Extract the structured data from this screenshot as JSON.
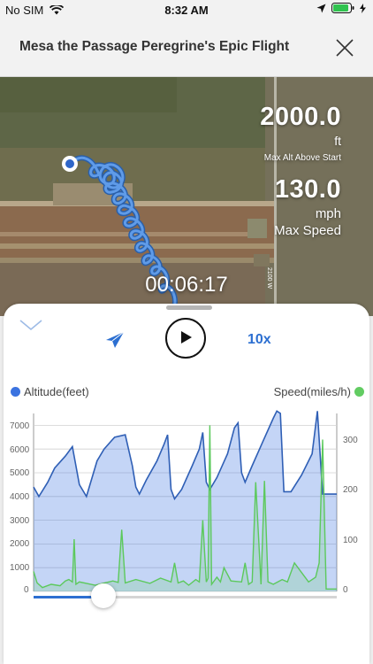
{
  "status_bar": {
    "carrier": "No SIM",
    "time": "8:32 AM"
  },
  "header": {
    "title": "Mesa the Passage Peregrine's Epic Flight"
  },
  "stats": {
    "altitude_value": "2000.0",
    "altitude_unit": "ft",
    "altitude_label": "Max Alt Above Start",
    "speed_value": "130.0",
    "speed_unit": "mph",
    "speed_label": "Max Speed"
  },
  "map": {
    "road_label": "2100 W"
  },
  "timer": "00:06:17",
  "controls": {
    "speed_multiplier": "10x",
    "playback_progress": 0.23
  },
  "colors": {
    "altitude": "#3b73e0",
    "speed": "#62cc62",
    "accent": "#2c6fd1"
  },
  "chart_data": {
    "type": "area",
    "series": [
      {
        "name": "Altitude(feet)",
        "axis": "left",
        "color": "#3b73e0",
        "x": [
          0,
          3,
          8,
          12,
          18,
          22,
          26,
          30,
          32,
          34,
          36,
          40,
          46,
          52,
          56,
          58,
          60,
          64,
          70,
          74,
          76,
          78,
          80,
          84,
          90,
          94,
          96,
          98,
          100,
          104,
          110,
          114,
          116,
          118,
          120,
          124,
          130,
          136,
          138,
          140,
          142,
          146,
          152,
          158,
          161,
          164,
          168,
          172
        ],
        "y": [
          4400,
          4000,
          4600,
          5200,
          5700,
          6100,
          4500,
          4000,
          4500,
          5000,
          5500,
          6000,
          6500,
          6600,
          5300,
          4400,
          4100,
          4700,
          5500,
          6200,
          6600,
          4300,
          3900,
          4300,
          5300,
          6000,
          6700,
          4600,
          4300,
          4800,
          5800,
          6900,
          7100,
          5000,
          4600,
          5300,
          6300,
          7300,
          7600,
          7500,
          4200,
          4200,
          4900,
          5800,
          7600,
          4100,
          4100,
          4100
        ]
      },
      {
        "name": "Speed(miles/h)",
        "axis": "right",
        "color": "#62cc62",
        "x": [
          0,
          2,
          5,
          10,
          15,
          18,
          20,
          22,
          23,
          24,
          26,
          35,
          45,
          48,
          50,
          52,
          58,
          66,
          72,
          78,
          80,
          82,
          85,
          88,
          92,
          94,
          96,
          98,
          99,
          100,
          101,
          104,
          106,
          108,
          112,
          118,
          120,
          122,
          124,
          126,
          129,
          131,
          133,
          136,
          141,
          144,
          148,
          156,
          160,
          162,
          164,
          166,
          168,
          172
        ],
        "y": [
          42,
          18,
          8,
          15,
          12,
          22,
          25,
          20,
          110,
          15,
          20,
          13,
          22,
          19,
          130,
          18,
          25,
          17,
          28,
          20,
          60,
          18,
          22,
          13,
          25,
          20,
          150,
          20,
          28,
          350,
          15,
          30,
          20,
          50,
          22,
          20,
          60,
          15,
          20,
          230,
          15,
          233,
          20,
          15,
          25,
          20,
          60,
          20,
          30,
          60,
          320,
          5,
          5,
          5
        ]
      }
    ],
    "left_axis": {
      "ylim": [
        0,
        7500
      ],
      "ticks": [
        "0",
        "1000",
        "2000",
        "3000",
        "4000",
        "5000",
        "6000",
        "7000"
      ]
    },
    "right_axis": {
      "ylim": [
        0,
        375
      ],
      "ticks": [
        "0",
        "100",
        "200",
        "300"
      ]
    },
    "grid": true,
    "legend": "top"
  }
}
